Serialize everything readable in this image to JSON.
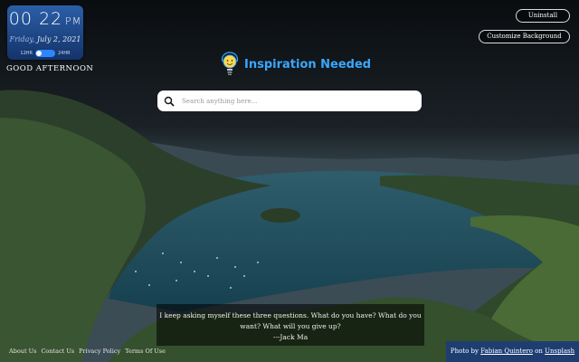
{
  "clock": {
    "time": "00 22",
    "ampm": "PM",
    "day": "Friday,",
    "date": "July 2, 2021",
    "format_12": "12HR",
    "format_24": "24HR",
    "greeting": "GOOD AFTERNOON"
  },
  "buttons": {
    "uninstall": "Uninstall",
    "customize": "Customize Background"
  },
  "logo": {
    "title": "Inspiration Needed"
  },
  "search": {
    "placeholder": "Search anything here..."
  },
  "quote": {
    "text": "I keep asking myself these three questions. What do you have? What do you want? What will you give up?",
    "author": "---Jack Ma"
  },
  "footer": {
    "links": [
      "About Us",
      "Contact Us",
      "Privacy Policy",
      "Terms Of Use"
    ]
  },
  "credit": {
    "prefix": "Photo by",
    "author": "Fabian Quintero",
    "on": "on",
    "site": "Unsplash"
  },
  "colors": {
    "accent": "#3aa7ff",
    "clock_card": "#2b5fa8",
    "credit_bg": "#1e3e72"
  }
}
